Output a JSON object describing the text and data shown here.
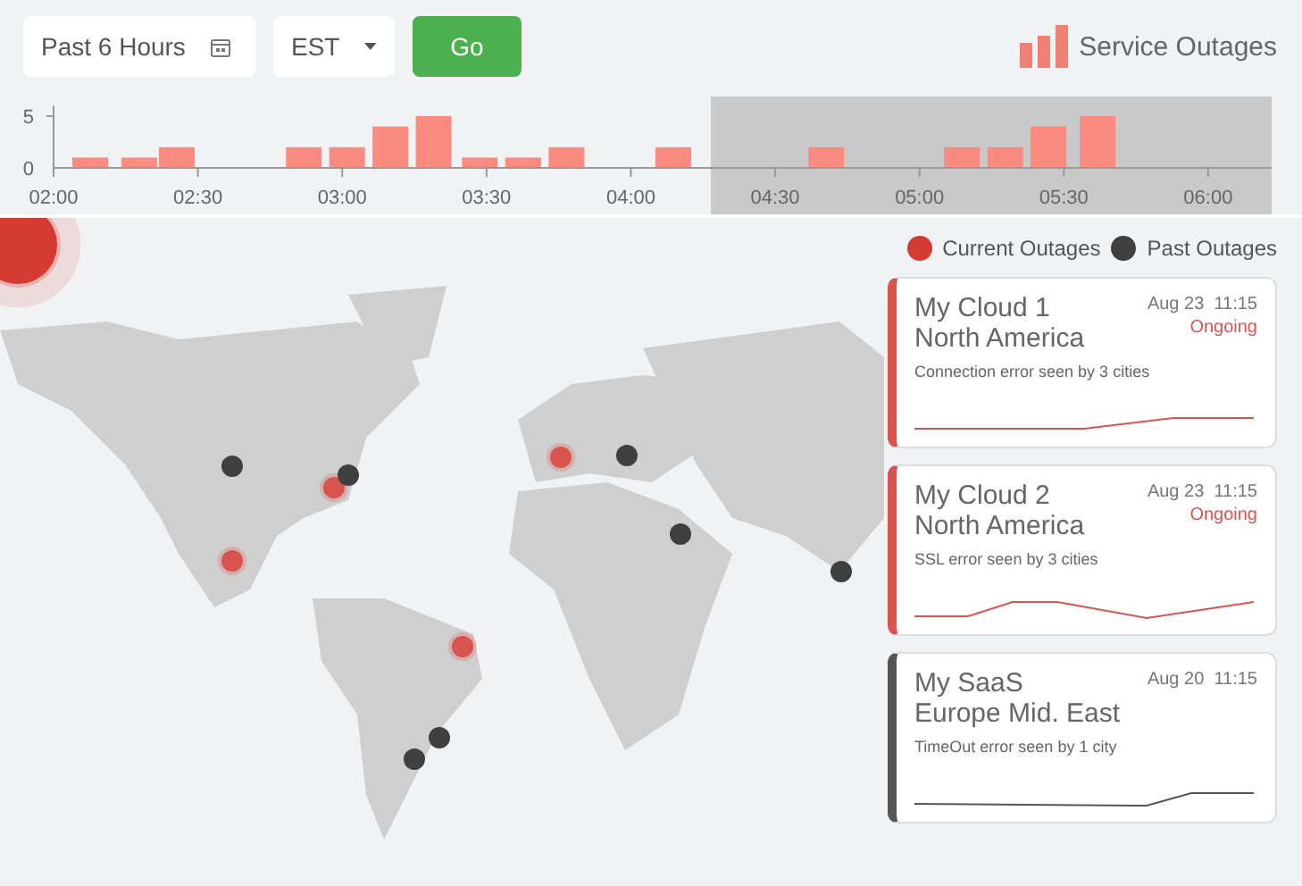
{
  "filters": {
    "range": {
      "value": "Past 6 Hours"
    },
    "timezone": {
      "value": "EST"
    },
    "go_button": "Go"
  },
  "title": "Service Outages",
  "timeline": {
    "chart_data": {
      "type": "bar",
      "x": [
        2.13,
        2.3,
        2.43,
        2.87,
        3.02,
        3.17,
        3.32,
        3.48,
        3.63,
        3.78,
        4.15,
        4.68,
        5.15,
        5.3,
        5.45,
        5.62
      ],
      "values": [
        1,
        1,
        2,
        2,
        2,
        4,
        5,
        1,
        1,
        2,
        2,
        2,
        2,
        2,
        4,
        5
      ],
      "xlim": [
        2,
        6.22
      ],
      "ylim": [
        0,
        6
      ],
      "yticks": [
        0,
        5
      ],
      "xticks": [
        {
          "value": 2,
          "label": "02:00"
        },
        {
          "value": 2.5,
          "label": "02:30"
        },
        {
          "value": 3,
          "label": "03:00"
        },
        {
          "value": 3.5,
          "label": "03:30"
        },
        {
          "value": 4,
          "label": "04:00"
        },
        {
          "value": 4.5,
          "label": "04:30"
        },
        {
          "value": 5,
          "label": "05:00"
        },
        {
          "value": 5.5,
          "label": "05:30"
        },
        {
          "value": 6,
          "label": "06:00"
        }
      ]
    }
  },
  "legend": [
    {
      "label": "Current Outages",
      "color": "#d23a32"
    },
    {
      "label": "Past Outages",
      "color": "#3f3f3f"
    }
  ],
  "markers": [
    {
      "kind": "current",
      "color": "#d23a32"
    },
    {
      "kind": "current",
      "color": "#d9534f"
    },
    {
      "kind": "current",
      "color": "#d9534f"
    },
    {
      "kind": "current",
      "color": "#d9534f"
    },
    {
      "kind": "current",
      "color": "#d9534f"
    },
    {
      "kind": "past",
      "color": "#3f3f3f"
    },
    {
      "kind": "past",
      "color": "#3f3f3f"
    },
    {
      "kind": "past",
      "color": "#3f3f3f"
    },
    {
      "kind": "past",
      "color": "#3f3f3f"
    },
    {
      "kind": "past",
      "color": "#3f3f3f"
    },
    {
      "kind": "past",
      "color": "#3f3f3f"
    },
    {
      "kind": "past",
      "color": "#3f3f3f"
    }
  ],
  "outages": [
    {
      "name": "My Cloud 1",
      "region": "North America",
      "date": "Aug 23",
      "time": "11:15",
      "status": "Ongoing",
      "description": "Connection error seen by 3 cities",
      "color": "#d9534f"
    },
    {
      "name": "My Cloud 2",
      "region": "North America",
      "date": "Aug 23",
      "time": "11:15",
      "status": "Ongoing",
      "description": "SSL error seen by 3 cities",
      "color": "#d9534f"
    },
    {
      "name": "My SaaS",
      "region": "Europe Mid. East",
      "date": "Aug 20",
      "time": "11:15",
      "description": "TimeOut error seen by 1 city",
      "color": "#555555"
    }
  ]
}
